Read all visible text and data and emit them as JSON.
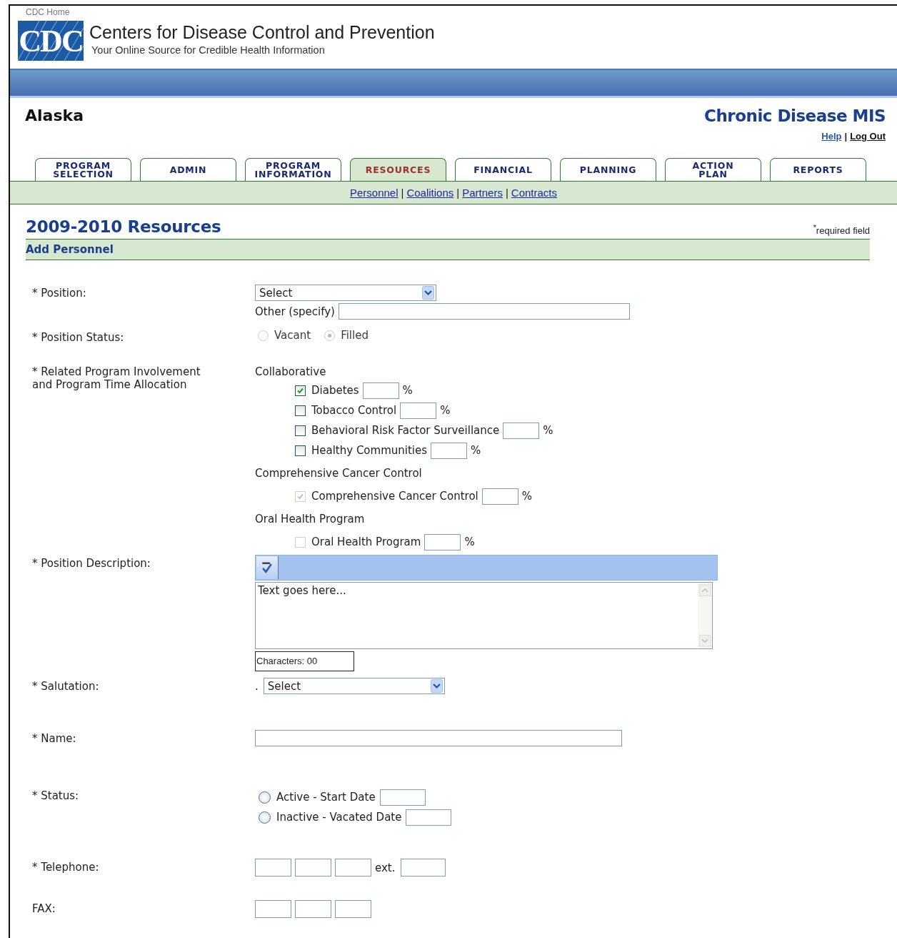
{
  "header": {
    "home_link": "CDC Home",
    "logo": "CDC",
    "title": "Centers for Disease Control and Prevention",
    "tagline": "Your Online Source for Credible Health Information"
  },
  "state": "Alaska",
  "app_title": "Chronic Disease MIS",
  "link_separator": "|",
  "user_links": [
    "Help",
    "Log Out"
  ],
  "tabs": [
    {
      "label": "PROGRAM\nSELECTION",
      "selected": false
    },
    {
      "label": "ADMIN",
      "selected": false
    },
    {
      "label": "PROGRAM\nINFORMATION",
      "selected": false
    },
    {
      "label": "RESOURCES",
      "selected": true
    },
    {
      "label": "FINANCIAL",
      "selected": false
    },
    {
      "label": "PLANNING",
      "selected": false
    },
    {
      "label": "ACTION\nPLAN",
      "selected": false
    },
    {
      "label": "REPORTS",
      "selected": false
    }
  ],
  "subnav": [
    "Personnel",
    "Coalitions",
    "Partners",
    "Contracts"
  ],
  "page_title": "2009-2010 Resources",
  "required_note": "$^{*}$required field",
  "section": "Add Personnel",
  "form": [
    {
      "kind": "select_other",
      "label": "* Position:",
      "value": "Select",
      "other_label": "Other (specify)"
    },
    {
      "kind": "radios",
      "label": "* Position Status:",
      "options": [
        {
          "label": "Vacant",
          "selected": false,
          "disabled": true
        },
        {
          "label": "Filled",
          "selected": true,
          "disabled": true
        }
      ]
    },
    {
      "kind": "programs",
      "label": "* Related Program Involvement\nand Program Time Allocation",
      "groups": [
        {
          "title": "Collaborative",
          "items": [
            {
              "label": "Diabetes",
              "checked": true,
              "disabled": false,
              "unit": "%"
            },
            {
              "label": "Tobacco Control",
              "checked": false,
              "disabled": false,
              "unit": "%"
            },
            {
              "label": "Behavioral Risk Factor Surveillance",
              "checked": false,
              "disabled": false,
              "unit": "%"
            },
            {
              "label": "Healthy Communities",
              "checked": false,
              "disabled": false,
              "unit": "%"
            }
          ]
        },
        {
          "title": "Comprehensive Cancer Control",
          "items": [
            {
              "label": "Comprehensive Cancer Control",
              "checked": true,
              "disabled": true,
              "unit": "%"
            }
          ]
        },
        {
          "title": "Oral Health Program",
          "items": [
            {
              "label": "Oral Health Program",
              "checked": false,
              "disabled": true,
              "unit": "%"
            }
          ]
        }
      ]
    },
    {
      "kind": "editor",
      "label": "* Position Description:",
      "placeholder": "Text goes here...",
      "counter": "Characters: 00"
    },
    {
      "kind": "select",
      "label": "* Salutation:",
      "prefix": ".",
      "value": "Select"
    },
    {
      "kind": "text",
      "label": "* Name:"
    },
    {
      "kind": "status",
      "label": "* Status:",
      "options": [
        {
          "label": "Active - Start Date",
          "selected": false
        },
        {
          "label": "Inactive - Vacated Date",
          "selected": false
        }
      ]
    },
    {
      "kind": "phone",
      "label": "* Telephone:",
      "ext_label": "ext."
    },
    {
      "kind": "phone",
      "label": "FAX:"
    }
  ]
}
